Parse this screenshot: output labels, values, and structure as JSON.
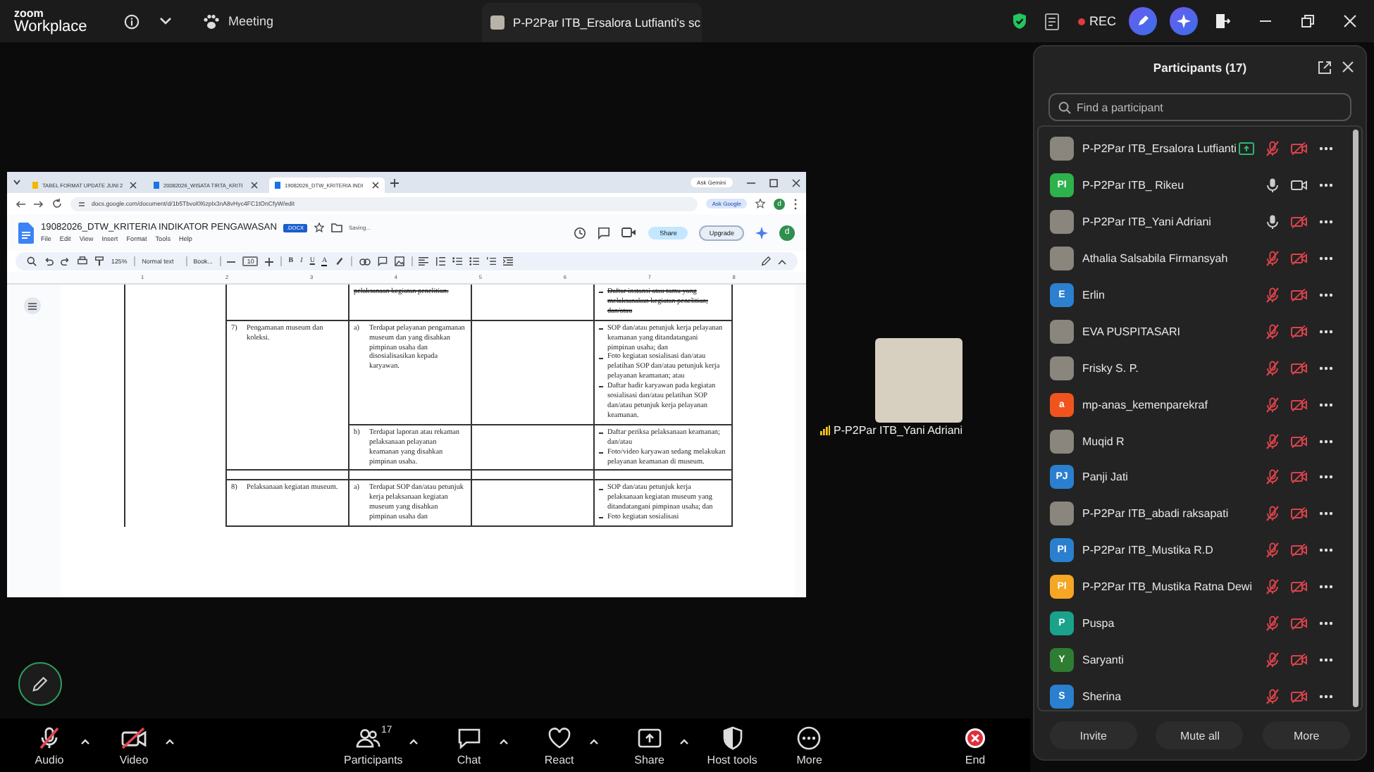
{
  "topbar": {
    "logo_top": "zoom",
    "logo_bottom": "Workplace",
    "meeting_label": "Meeting",
    "share_tab": "P-P2Par ITB_Ersalora Lutfianti's sc",
    "rec_label": "REC"
  },
  "shared_screen": {
    "browser_tabs": [
      {
        "title": "TABEL FORMAT UPDATE JUNI 2",
        "selected": false,
        "kind": "sheet"
      },
      {
        "title": "20082026_WISATA TIRTA_KRITI",
        "selected": false,
        "kind": "doc"
      },
      {
        "title": "19082026_DTW_KRITERIA INDI",
        "selected": true,
        "kind": "doc"
      }
    ],
    "ask_gemini": "Ask Gemini",
    "url": "docs.google.com/document/d/1b5Tbvol0l6zplx3nA8vHyc4FC1tOnCfyW/edit",
    "ask_google": "Ask Google",
    "browser_account_initial": "d",
    "doc_title": "19082026_DTW_KRITERIA INDIKATOR PENGAWASAN",
    "doc_badge": ".DOCX",
    "save_status": "Saving...",
    "menu": [
      "File",
      "Edit",
      "View",
      "Insert",
      "Format",
      "Tools",
      "Help"
    ],
    "share": "Share",
    "upgrade": "Upgrade",
    "doc_account_initial": "d",
    "toolbar": {
      "zoom": "125%",
      "style": "Normal text",
      "font": "Book...",
      "size": "10",
      "format": [
        "B",
        "I",
        "U",
        "A"
      ]
    },
    "ruler": [
      "1",
      "2",
      "3",
      "4",
      "5",
      "6",
      "7",
      "8"
    ],
    "table": [
      {
        "kind": "continued",
        "subs": [
          {
            "text": "pelaksanaan kegiatan penelitian.",
            "struck": true,
            "evidence": [
              {
                "text": "Daftar instansi atau tamu yang melaksanakan kegiatan penelitian; dan/atau",
                "struck": true
              }
            ]
          }
        ]
      },
      {
        "kind": "criterion",
        "number": "7)",
        "criterion": "Pengamanan museum dan koleksi.",
        "subs": [
          {
            "letter": "a)",
            "text": "Terdapat pelayanan pengamanan museum dan yang disahkan pimpinan usaha dan disosialisasikan kepada karyawan.",
            "struck": false,
            "evidence": [
              {
                "text": "SOP dan/atau petunjuk kerja pelayanan keamanan yang ditandatangani pimpinan usaha; dan",
                "struck": false
              },
              {
                "text": "Foto kegiatan sosialisasi dan/atau pelatihan SOP dan/atau petunjuk kerja pelayanan keamanan; atau",
                "struck": false
              },
              {
                "text": "Daftar hadir karyawan pada kegiatan sosialisasi dan/atau pelatihan SOP dan/atau petunjuk kerja pelayanan keamanan.",
                "struck": false
              }
            ]
          },
          {
            "letter": "b)",
            "text": "Terdapat laporan atau rekaman pelaksanaan pelayanan keamanan yang disahkan pimpinan usaha.",
            "struck": false,
            "evidence": [
              {
                "text": "Daftar periksa pelaksanaan keamanan; dan/atau",
                "struck": false
              },
              {
                "text": "Foto/video karyawan sedang melakukan pelayanan keamanan di museum.",
                "struck": false
              }
            ]
          }
        ]
      },
      {
        "kind": "spacer"
      },
      {
        "kind": "criterion",
        "number": "8)",
        "criterion": "Pelaksanaan kegiatan museum.",
        "subs": [
          {
            "letter": "a)",
            "text": "Terdapat SOP dan/atau petunjuk kerja pelaksanaan kegiatan museum yang disahkan pimpinan usaha dan",
            "struck": false,
            "evidence": [
              {
                "text": "SOP dan/atau petunjuk kerja pelaksanaan kegiatan museum yang ditandatangani pimpinan usaha; dan",
                "struck": false
              },
              {
                "text": "Foto kegiatan sosialisasi",
                "struck": false
              }
            ]
          }
        ]
      }
    ]
  },
  "video_tile": {
    "name": "P-P2Par ITB_Yani Adriani"
  },
  "participants": {
    "title": "Participants (17)",
    "search_placeholder": "Find a participant",
    "people": [
      {
        "name": "P-P2Par ITB_Ersalora Lutfianti",
        "kind": "photo",
        "sharing": true,
        "muted": true,
        "video_on": false
      },
      {
        "name": "P-P2Par ITB_ Rikeu",
        "kind": "initials",
        "initials": "PI",
        "color": "#2eb24c",
        "sharing": false,
        "muted": false,
        "video_on": true
      },
      {
        "name": "P-P2Par ITB_Yani Adriani",
        "kind": "photo",
        "sharing": false,
        "muted": false,
        "video_on": false
      },
      {
        "name": "Athalia Salsabila Firmansyah",
        "kind": "photo",
        "sharing": false,
        "muted": true,
        "video_on": false
      },
      {
        "name": "Erlin",
        "kind": "initials",
        "initials": "E",
        "color": "#2d7fd0",
        "sharing": false,
        "muted": true,
        "video_on": false
      },
      {
        "name": "EVA PUSPITASARI",
        "kind": "photo",
        "sharing": false,
        "muted": true,
        "video_on": false
      },
      {
        "name": "Frisky S. P.",
        "kind": "photo",
        "sharing": false,
        "muted": true,
        "video_on": false
      },
      {
        "name": "mp-anas_kemenparekraf",
        "kind": "initials",
        "initials": "a",
        "color": "#f0541e",
        "sharing": false,
        "muted": true,
        "video_on": false
      },
      {
        "name": "Muqid R",
        "kind": "photo",
        "sharing": false,
        "muted": true,
        "video_on": false
      },
      {
        "name": "Panji Jati",
        "kind": "initials",
        "initials": "PJ",
        "color": "#2b7fcf",
        "sharing": false,
        "muted": true,
        "video_on": false
      },
      {
        "name": "P-P2Par ITB_abadi raksapati",
        "kind": "photo",
        "sharing": false,
        "muted": true,
        "video_on": false
      },
      {
        "name": "P-P2Par ITB_Mustika R.D",
        "kind": "initials",
        "initials": "PI",
        "color": "#2b7fcf",
        "sharing": false,
        "muted": true,
        "video_on": false
      },
      {
        "name": "P-P2Par ITB_Mustika Ratna Dewi",
        "kind": "initials",
        "initials": "PI",
        "color": "#f5a623",
        "sharing": false,
        "muted": true,
        "video_on": false
      },
      {
        "name": "Puspa",
        "kind": "initials",
        "initials": "P",
        "color": "#1aa38a",
        "sharing": false,
        "muted": true,
        "video_on": false
      },
      {
        "name": "Saryanti",
        "kind": "initials",
        "initials": "Y",
        "color": "#2e7d32",
        "sharing": false,
        "muted": true,
        "video_on": false
      },
      {
        "name": "Sherina",
        "kind": "initials",
        "initials": "S",
        "color": "#2b7fcf",
        "sharing": false,
        "muted": true,
        "video_on": false
      }
    ],
    "buttons": [
      "Invite",
      "Mute all",
      "More"
    ]
  },
  "meeting_controls": [
    {
      "kind": "audio",
      "label": "Audio",
      "off": true,
      "caret": true
    },
    {
      "kind": "video",
      "label": "Video",
      "off": true,
      "caret": true
    },
    {
      "kind": "participants",
      "label": "Participants",
      "count": "17",
      "caret": true
    },
    {
      "kind": "chat",
      "label": "Chat",
      "caret": true
    },
    {
      "kind": "react",
      "label": "React",
      "caret": true
    },
    {
      "kind": "share",
      "label": "Share",
      "caret": true
    },
    {
      "kind": "host_tools",
      "label": "Host tools",
      "caret": false
    },
    {
      "kind": "more",
      "label": "More",
      "caret": false
    },
    {
      "kind": "end",
      "label": "End",
      "caret": false
    }
  ]
}
